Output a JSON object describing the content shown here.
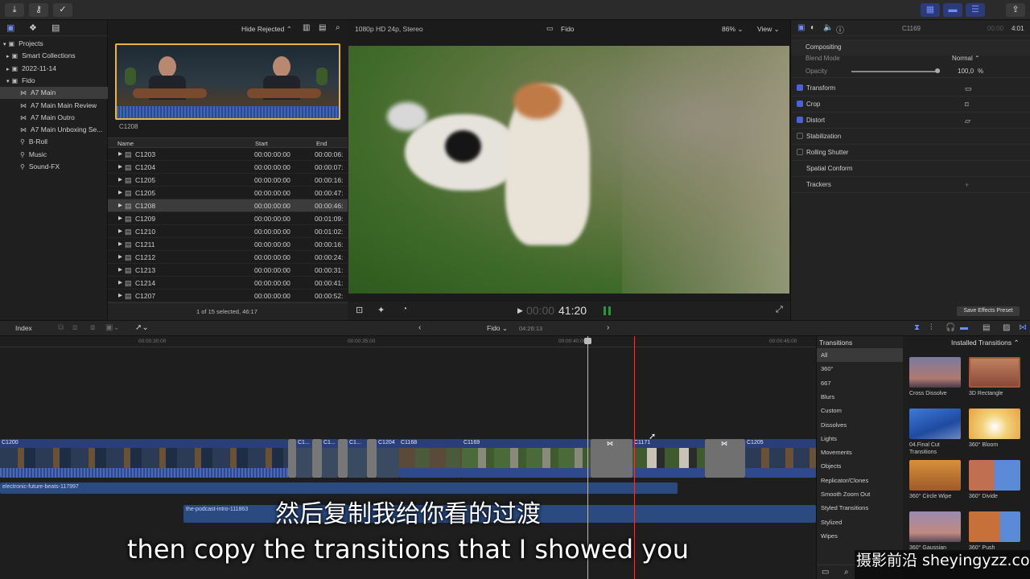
{
  "topbar": {
    "import_icon": "download-icon",
    "keywords_icon": "key-icon",
    "background_tasks_icon": "checkmark-circle-icon",
    "share_icon": "share-icon",
    "accent": "#6f8cff"
  },
  "library": {
    "items": [
      {
        "label": "Projects",
        "icon": "library-icon"
      },
      {
        "label": "Smart Collections",
        "icon": "folder-icon"
      },
      {
        "label": "2022-11-14",
        "icon": "event-icon"
      },
      {
        "label": "Fido",
        "icon": "event-icon"
      },
      {
        "label": "A7 Main",
        "icon": "project-icon"
      },
      {
        "label": "A7 Main Main Review",
        "icon": "project-icon"
      },
      {
        "label": "A7 Main Outro",
        "icon": "project-icon"
      },
      {
        "label": "A7 Main Unboxing Se...",
        "icon": "project-icon"
      },
      {
        "label": "B-Roll",
        "icon": "keyword-icon"
      },
      {
        "label": "Music",
        "icon": "keyword-icon"
      },
      {
        "label": "Sound-FX",
        "icon": "keyword-icon"
      }
    ]
  },
  "browser": {
    "filter": "Hide Rejected",
    "clip_name": "C1208",
    "columns": [
      "Name",
      "Start",
      "End"
    ],
    "rows": [
      {
        "name": "C1203",
        "start": "00:00:00:00",
        "end": "00:00:06:"
      },
      {
        "name": "C1204",
        "start": "00:00:00:00",
        "end": "00:00:07:"
      },
      {
        "name": "C1205",
        "start": "00:00:00:00",
        "end": "00:00:16:"
      },
      {
        "name": "C1205",
        "start": "00:00:00:00",
        "end": "00:00:47:"
      },
      {
        "name": "C1208",
        "start": "00:00:00:00",
        "end": "00:00:46:"
      },
      {
        "name": "C1209",
        "start": "00:00:00:00",
        "end": "00:01:09:"
      },
      {
        "name": "C1210",
        "start": "00:00:00:00",
        "end": "00:01:02:"
      },
      {
        "name": "C1211",
        "start": "00:00:00:00",
        "end": "00:00:16:"
      },
      {
        "name": "C1212",
        "start": "00:00:00:00",
        "end": "00:00:24:"
      },
      {
        "name": "C1213",
        "start": "00:00:00:00",
        "end": "00:00:31:"
      },
      {
        "name": "C1214",
        "start": "00:00:00:00",
        "end": "00:00:41:"
      },
      {
        "name": "C1207",
        "start": "00:00:00:00",
        "end": "00:00:52:"
      }
    ],
    "selected_row": 4,
    "status": "1 of 15 selected, 46:17"
  },
  "viewer": {
    "format": "1080p HD 24p, Stereo",
    "project": "Fido",
    "zoom": "86%",
    "view": "View",
    "timecode_dim": "00:00",
    "timecode": "41:20"
  },
  "inspector": {
    "clip": "C1169",
    "duration_dim": "00:00",
    "duration": "4:01",
    "compositing": "Compositing",
    "blend_mode_label": "Blend Mode",
    "blend_mode_value": "Normal",
    "opacity_label": "Opacity",
    "opacity_value": "100,0",
    "opacity_unit": "%",
    "opacity_level": 1.0,
    "rows": [
      {
        "label": "Transform",
        "checked": true
      },
      {
        "label": "Crop",
        "checked": true
      },
      {
        "label": "Distort",
        "checked": true
      },
      {
        "label": "Stabilization",
        "checked": false
      },
      {
        "label": "Rolling Shutter",
        "checked": false
      },
      {
        "label": "Spatial Conform",
        "checked": null
      },
      {
        "label": "Trackers",
        "checked": null
      }
    ],
    "save_preset": "Save Effects Preset"
  },
  "timeline_bar": {
    "index": "Index",
    "project": "Fido",
    "duration": "04:26:13"
  },
  "ruler": {
    "ticks": [
      "00:00:30:00",
      "00:00:35:00",
      "00:00:40:00",
      "00:00:45:00"
    ]
  },
  "timeline": {
    "clips": [
      {
        "label": "C1200"
      },
      {
        "label": "C1..."
      },
      {
        "label": "C1..."
      },
      {
        "label": "C1..."
      },
      {
        "label": "C1204"
      },
      {
        "label": "C1168"
      },
      {
        "label": "C1169"
      },
      {
        "label": "C1171"
      },
      {
        "label": "C1205"
      }
    ],
    "audio": [
      {
        "label": "electronic-future-beats-117997"
      },
      {
        "label": "the-podcast-intro-111863"
      }
    ]
  },
  "transitions": {
    "header": "Transitions",
    "installed": "Installed Transitions",
    "categories": [
      "All",
      "360°",
      "667",
      "Blurs",
      "Custom",
      "Dissolves",
      "Lights",
      "Movements",
      "Objects",
      "Replicator/Clones",
      "Smooth Zoom Out",
      "Styled Transitions",
      "Stylized",
      "Wipes"
    ],
    "selected_category": 0,
    "items": [
      {
        "label": "Cross Dissolve"
      },
      {
        "label": "3D Rectangle"
      },
      {
        "label": "04.Final Cut Transitions"
      },
      {
        "label": "360° Bloom"
      },
      {
        "label": "360° Circle Wipe"
      },
      {
        "label": "360° Divide"
      },
      {
        "label": "360° Gaussian"
      },
      {
        "label": "360° Push"
      }
    ]
  },
  "subtitles": {
    "chinese": "然后复制我给你看的过渡",
    "english": "then copy the transitions that I showed you"
  },
  "watermark": {
    "text": "摄影前沿 sheyingyzz.com"
  }
}
